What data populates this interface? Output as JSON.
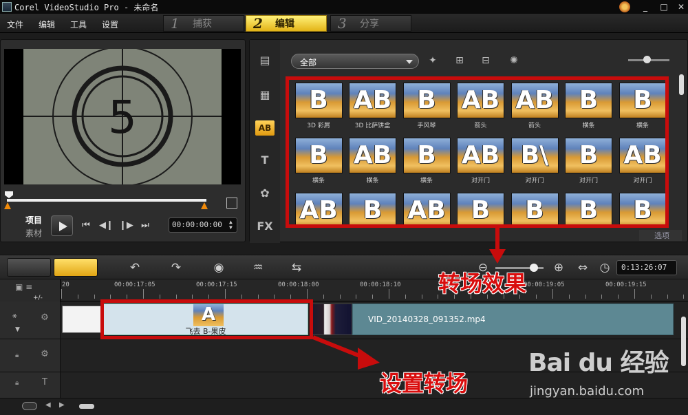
{
  "window": {
    "title": "Corel VideoStudio Pro - 未命名",
    "controls": [
      "_",
      "□",
      "✕"
    ]
  },
  "menu": {
    "items": [
      "文件",
      "编辑",
      "工具",
      "设置"
    ],
    "steps": [
      {
        "num": "1",
        "label": "捕获",
        "active": false
      },
      {
        "num": "2",
        "label": "编辑",
        "active": true
      },
      {
        "num": "3",
        "label": "分享",
        "active": false
      }
    ]
  },
  "preview": {
    "countdown_digit": "5",
    "mode_project": "项目",
    "mode_clip": "素材",
    "timecode": "00:00:00:00",
    "transport": [
      "⏮",
      "◀❙",
      "❙▶",
      "⏭"
    ]
  },
  "library": {
    "nav_icons": [
      "media-icon",
      "instant-project-icon",
      "transition-icon",
      "title-icon",
      "graphic-icon",
      "filter-icon"
    ],
    "nav_labels": {
      "transition": "AB",
      "title": "T",
      "filter": "FX"
    },
    "filter": "全部",
    "zoom_level": 0.45,
    "options_label": "选项",
    "transitions": [
      {
        "label": "3D 彩屑",
        "glyph": "B"
      },
      {
        "label": "3D 比萨饼盒",
        "glyph": "AB"
      },
      {
        "label": "手风琴",
        "glyph": "B"
      },
      {
        "label": "箭头",
        "glyph": "AB"
      },
      {
        "label": "箭头",
        "glyph": "AB"
      },
      {
        "label": "横条",
        "glyph": "B"
      },
      {
        "label": "横条",
        "glyph": "B B"
      },
      {
        "label": "横条",
        "glyph": "B"
      },
      {
        "label": "横条",
        "glyph": "AB"
      },
      {
        "label": "横条",
        "glyph": "B"
      },
      {
        "label": "对开门",
        "glyph": "AB"
      },
      {
        "label": "对开门",
        "glyph": "B\\"
      },
      {
        "label": "对开门",
        "glyph": "B"
      },
      {
        "label": "对开门",
        "glyph": "AB"
      },
      {
        "label": "",
        "glyph": "AB"
      },
      {
        "label": "",
        "glyph": "B"
      },
      {
        "label": "",
        "glyph": "AB"
      },
      {
        "label": "",
        "glyph": "B"
      },
      {
        "label": "",
        "glyph": "B"
      },
      {
        "label": "",
        "glyph": "B"
      },
      {
        "label": "",
        "glyph": "B"
      }
    ]
  },
  "timeline": {
    "tool_icons": [
      "undo-icon",
      "redo-icon",
      "record-capture-icon",
      "sound-mixer-icon",
      "auto-music-icon"
    ],
    "zoom_level": 0.8,
    "duration": "0:13:26:07",
    "ruler": [
      "20",
      "00:00:17:05",
      "00:00:17:15",
      "00:00:18:00",
      "00:00:18:10",
      "00:00:19:05",
      "00:00:19:15"
    ],
    "track_add_label": "+/-",
    "transition_clip_name": "飞去 B-果皮",
    "transition_clip_glyph": "A",
    "main_clip_name": "VID_20140328_091352.mp4"
  },
  "annotations": {
    "transition_effect": "转场效果",
    "set_transition": "设置转场"
  },
  "watermark": {
    "logo": "Bai du 经验",
    "url": "jingyan.baidu.com"
  },
  "colors": {
    "accent_yellow": "#f2c62a",
    "annotation_red": "#c80c0c",
    "main_clip": "#5d8893",
    "transition_clip": "#d4e3ec"
  }
}
